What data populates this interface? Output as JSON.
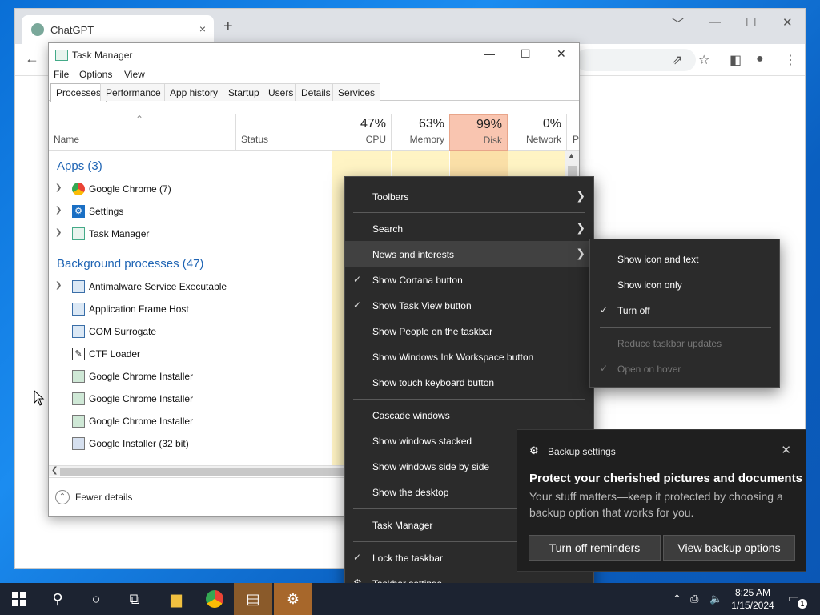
{
  "chrome": {
    "tab_title": "ChatGPT",
    "tab_close": "×",
    "new_tab": "+",
    "back": "←",
    "win_min": "﹀",
    "win_minimize": "—",
    "win_max": "☐",
    "win_close": "✕",
    "toolbar_icons": [
      "share-icon",
      "star-icon",
      "sidepanel-icon",
      "profile-icon",
      "menu-icon"
    ]
  },
  "task_manager": {
    "title": "Task Manager",
    "menu": [
      "File",
      "Options",
      "View"
    ],
    "tabs": [
      "Processes",
      "Performance",
      "App history",
      "Startup",
      "Users",
      "Details",
      "Services"
    ],
    "columns": {
      "name": "Name",
      "status": "Status",
      "cpu_pct": "47%",
      "cpu": "CPU",
      "memory_pct": "63%",
      "memory": "Memory",
      "disk_pct": "99%",
      "disk": "Disk",
      "network_pct": "0%",
      "network": "Network",
      "more": "P"
    },
    "apps_header": "Apps (3)",
    "apps": [
      "Google Chrome (7)",
      "Settings",
      "Task Manager"
    ],
    "bg_header": "Background processes (47)",
    "background": [
      "Antimalware Service Executable",
      "Application Frame Host",
      "COM Surrogate",
      "CTF Loader",
      "Google Chrome Installer",
      "Google Chrome Installer",
      "Google Chrome Installer",
      "Google Installer (32 bit)"
    ],
    "fewer_details": "Fewer details"
  },
  "context_menu": {
    "toolbars": "Toolbars",
    "search": "Search",
    "news": "News and interests",
    "cortana": "Show Cortana button",
    "taskview": "Show Task View button",
    "people": "Show People on the taskbar",
    "ink": "Show Windows Ink Workspace button",
    "touch": "Show touch keyboard button",
    "cascade": "Cascade windows",
    "stacked": "Show windows stacked",
    "side": "Show windows side by side",
    "desktop": "Show the desktop",
    "taskmgr": "Task Manager",
    "lock": "Lock the taskbar",
    "settings": "Taskbar settings"
  },
  "submenu": {
    "icon_text": "Show icon and text",
    "icon_only": "Show icon only",
    "turn_off": "Turn off",
    "reduce": "Reduce taskbar updates",
    "hover": "Open on hover"
  },
  "toast": {
    "app": "Backup settings",
    "heading": "Protect your cherished pictures and documents",
    "message": "Your stuff matters—keep it protected by choosing a backup option that works for you.",
    "btn1": "Turn off reminders",
    "btn2": "View backup options"
  },
  "taskbar": {
    "time": "8:25 AM",
    "date": "1/15/2024",
    "notif_count": "1"
  },
  "colors": {
    "desktop": "#0a6fd6",
    "disk_highlight": "#f9c5b0",
    "usage_fill": "#fff4c4",
    "menu_bg": "#2b2b2b",
    "link_blue": "#1e64b4"
  }
}
